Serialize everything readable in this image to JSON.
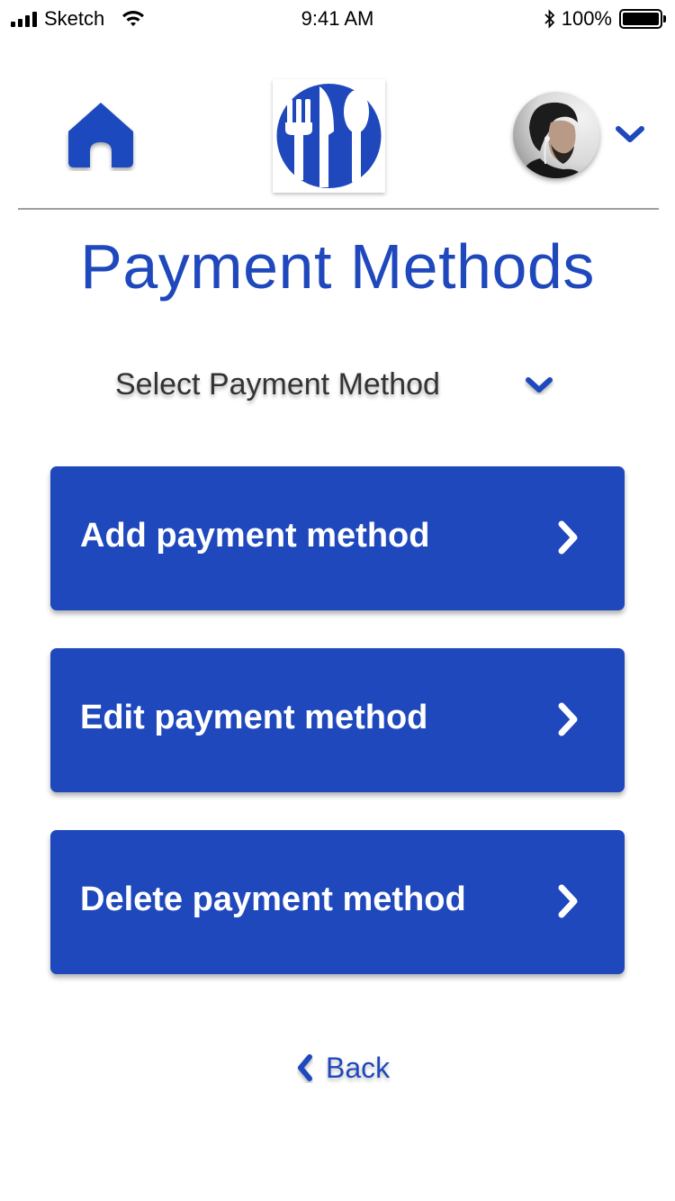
{
  "status_bar": {
    "carrier": "Sketch",
    "time": "9:41 AM",
    "battery_percent": "100%",
    "signal_icon": "signal-bars-icon",
    "wifi_icon": "wifi-icon",
    "bluetooth_icon": "bluetooth-icon",
    "battery_icon": "battery-icon"
  },
  "header": {
    "home_icon": "home-icon",
    "logo_icon": "fork-knife-spoon-icon",
    "avatar": "user-avatar",
    "menu_icon": "chevron-down-icon"
  },
  "page": {
    "title": "Payment Methods"
  },
  "select": {
    "label": "Select Payment Method",
    "icon": "chevron-down-icon"
  },
  "actions": [
    {
      "label": "Add payment method",
      "icon": "chevron-right-icon"
    },
    {
      "label": "Edit payment method",
      "icon": "chevron-right-icon"
    },
    {
      "label": "Delete payment method",
      "icon": "chevron-right-icon"
    }
  ],
  "back": {
    "label": "Back",
    "icon": "chevron-left-icon"
  },
  "colors": {
    "brand_blue": "#1f48bd",
    "button_text": "#ffffff",
    "divider": "#9e9e9e"
  }
}
